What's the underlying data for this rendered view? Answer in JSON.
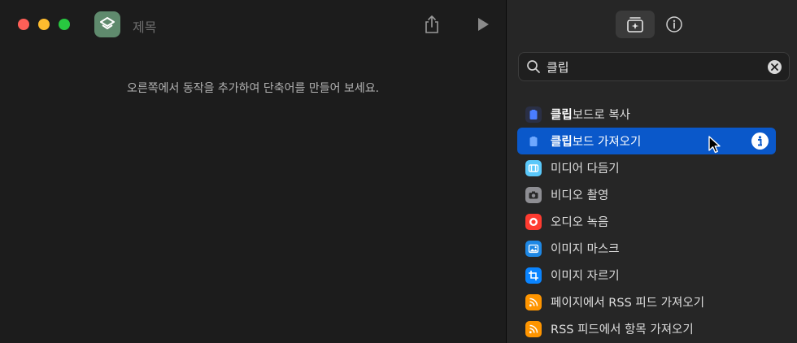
{
  "window": {
    "title": "제목",
    "empty_message": "오른쪽에서 동작을 추가하여 단축어를 만들어 보세요."
  },
  "toolbar": {
    "share_icon": "share-icon",
    "run_icon": "play-icon"
  },
  "sidebar_tabs": [
    {
      "name": "action-library",
      "icon": "library-sparkle-icon",
      "selected": true
    },
    {
      "name": "details",
      "icon": "info-icon",
      "selected": false
    }
  ],
  "search": {
    "value": "클립",
    "placeholder": "동작 검색"
  },
  "actions": [
    {
      "match": "클립",
      "rest": "보드로 복사",
      "icon": "clipboard-icon",
      "icon_bg": "#2a2f45",
      "icon_fg": "#4a7dff",
      "selected": false
    },
    {
      "match": "클립",
      "rest": "보드 가져오기",
      "icon": "clipboard-icon",
      "icon_bg": "#0a58ca",
      "icon_fg": "#6ea8ff",
      "selected": true
    },
    {
      "match": "",
      "rest": "미디어 다듬기",
      "icon": "trim-media-icon",
      "icon_bg": "#5ac8fa",
      "icon_fg": "#ffffff",
      "selected": false
    },
    {
      "match": "",
      "rest": "비디오 촬영",
      "icon": "camera-icon",
      "icon_bg": "#8e8e93",
      "icon_fg": "#2a2a2a",
      "selected": false
    },
    {
      "match": "",
      "rest": "오디오 녹음",
      "icon": "record-icon",
      "icon_bg": "#ff3b30",
      "icon_fg": "#ffffff",
      "selected": false
    },
    {
      "match": "",
      "rest": "이미지 마스크",
      "icon": "photo-icon",
      "icon_bg": "#1e88e5",
      "icon_fg": "#ffffff",
      "selected": false
    },
    {
      "match": "",
      "rest": "이미지 자르기",
      "icon": "crop-icon",
      "icon_bg": "#0a84ff",
      "icon_fg": "#ffffff",
      "selected": false
    },
    {
      "match": "",
      "rest": "페이지에서 RSS 피드 가져오기",
      "icon": "rss-icon",
      "icon_bg": "#ff9500",
      "icon_fg": "#ffffff",
      "selected": false
    },
    {
      "match": "",
      "rest": "RSS 피드에서 항목 가져오기",
      "icon": "rss-icon",
      "icon_bg": "#ff9500",
      "icon_fg": "#ffffff",
      "selected": false
    }
  ],
  "colors": {
    "accent": "#0a58ca",
    "app_icon": "#5f8a6d"
  }
}
